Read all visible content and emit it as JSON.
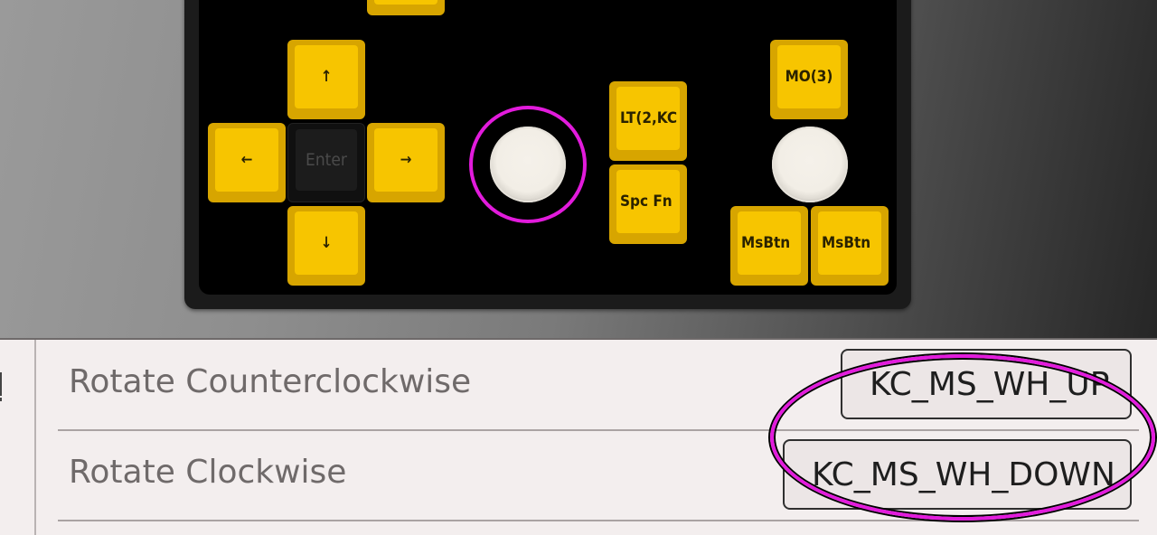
{
  "keys": {
    "up": "↑",
    "left": "←",
    "enter": "Enter",
    "right": "→",
    "down": "↓",
    "lt": "LT(2,KC",
    "spcfn": "Spc Fn",
    "mo3": "MO(3)",
    "msbtn1": "MsBtn",
    "msbtn2": "MsBtn"
  },
  "encoder_settings": {
    "ccw_label": "Rotate Counterclockwise",
    "ccw_value": "KC_MS_WH_UP",
    "cw_label": "Rotate Clockwise",
    "cw_value": "KC_MS_WH_DOWN"
  },
  "colors": {
    "key_yellow": "#f7c500",
    "highlight": "#e21bdc"
  }
}
